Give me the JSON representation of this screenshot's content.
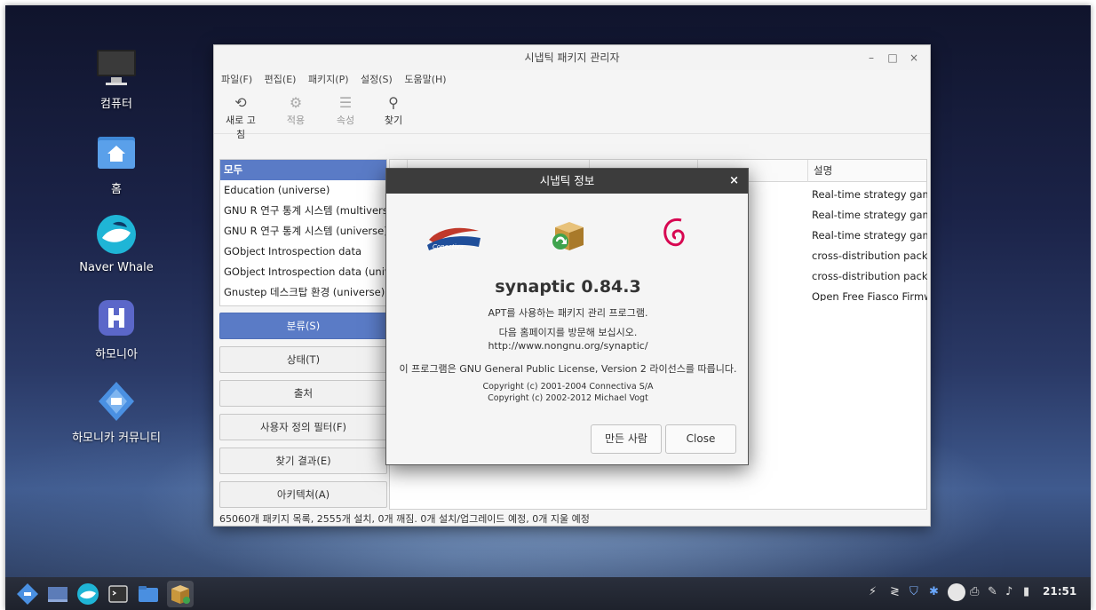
{
  "desktop": {
    "icons": [
      {
        "label": "컴퓨터",
        "icon": "monitor-icon"
      },
      {
        "label": "홈",
        "icon": "home-folder-icon"
      },
      {
        "label": "Naver Whale",
        "icon": "whale-browser-icon"
      },
      {
        "label": "하모니아",
        "icon": "hamonia-icon"
      },
      {
        "label": "하모니카 커뮤니티",
        "icon": "hamonikr-community-icon"
      }
    ]
  },
  "window": {
    "title": "시냅틱 패키지 관리자",
    "controls": {
      "minimize": "–",
      "maximize": "□",
      "close": "×"
    },
    "menu": [
      "파일(F)",
      "편집(E)",
      "패키지(P)",
      "설정(S)",
      "도움말(H)"
    ],
    "toolbar": [
      {
        "label": "새로 고침",
        "icon": "refresh-icon",
        "glyph": "⟲",
        "enabled": true
      },
      {
        "label": "적용",
        "icon": "gear-icon",
        "glyph": "⚙",
        "enabled": false
      },
      {
        "label": "속성",
        "icon": "properties-icon",
        "glyph": "☰",
        "enabled": false
      },
      {
        "label": "찾기",
        "icon": "search-icon",
        "glyph": "⚲",
        "enabled": true
      }
    ],
    "categories": [
      "모두",
      "Education (universe)",
      "GNU R 연구 통계 시스템 (multiverse)",
      "GNU R 연구 통계 시스템 (universe)",
      "GObject Introspection data",
      "GObject Introspection data (universe)",
      "Gnustep 데스크탑 환경 (universe)"
    ],
    "filter_buttons": [
      "분류(S)",
      "상태(T)",
      "출처",
      "사용자 정의 필터(F)",
      "찾기 결과(E)",
      "아키텍쳐(A)"
    ],
    "table": {
      "header_description": "설명",
      "descriptions": [
        "Real-time strategy game",
        "Real-time strategy game",
        "Real-time strategy game",
        "cross-distribution packa",
        "cross-distribution packa",
        "Open Free Fiasco Firmw"
      ]
    },
    "status": "65060개 패키지 목록, 2555개 설치, 0개 깨짐. 0개 설치/업그레이드 예정, 0개 지울 예정"
  },
  "dialog": {
    "title": "시냅틱 정보",
    "close": "×",
    "logo_text": "Conectiva",
    "app_name": "synaptic 0.84.3",
    "desc": "APT를 사용하는 패키지 관리 프로그램.",
    "visit": "다음 홈페이지를 방문해 보십시오.",
    "url": "http://www.nongnu.org/synaptic/",
    "license": "이 프로그램은 GNU General Public License, Version 2 라이선스를 따릅니다.",
    "copyright1": "Copyright (c) 2001-2004 Connectiva S/A",
    "copyright2": "Copyright (c) 2002-2012 Michael Vogt",
    "credits_button": "만든 사람",
    "close_button": "Close"
  },
  "taskbar": {
    "clock": "21:51",
    "apps": [
      "hamonikr-menu-icon",
      "show-desktop-icon",
      "whale-browser-icon",
      "terminal-icon",
      "file-manager-icon",
      "synaptic-icon"
    ],
    "tray": [
      "network-icon",
      "update-icon",
      "shield-icon",
      "bluetooth-icon",
      "user-icon",
      "printer-icon",
      "pen-icon",
      "volume-icon",
      "battery-icon"
    ]
  }
}
